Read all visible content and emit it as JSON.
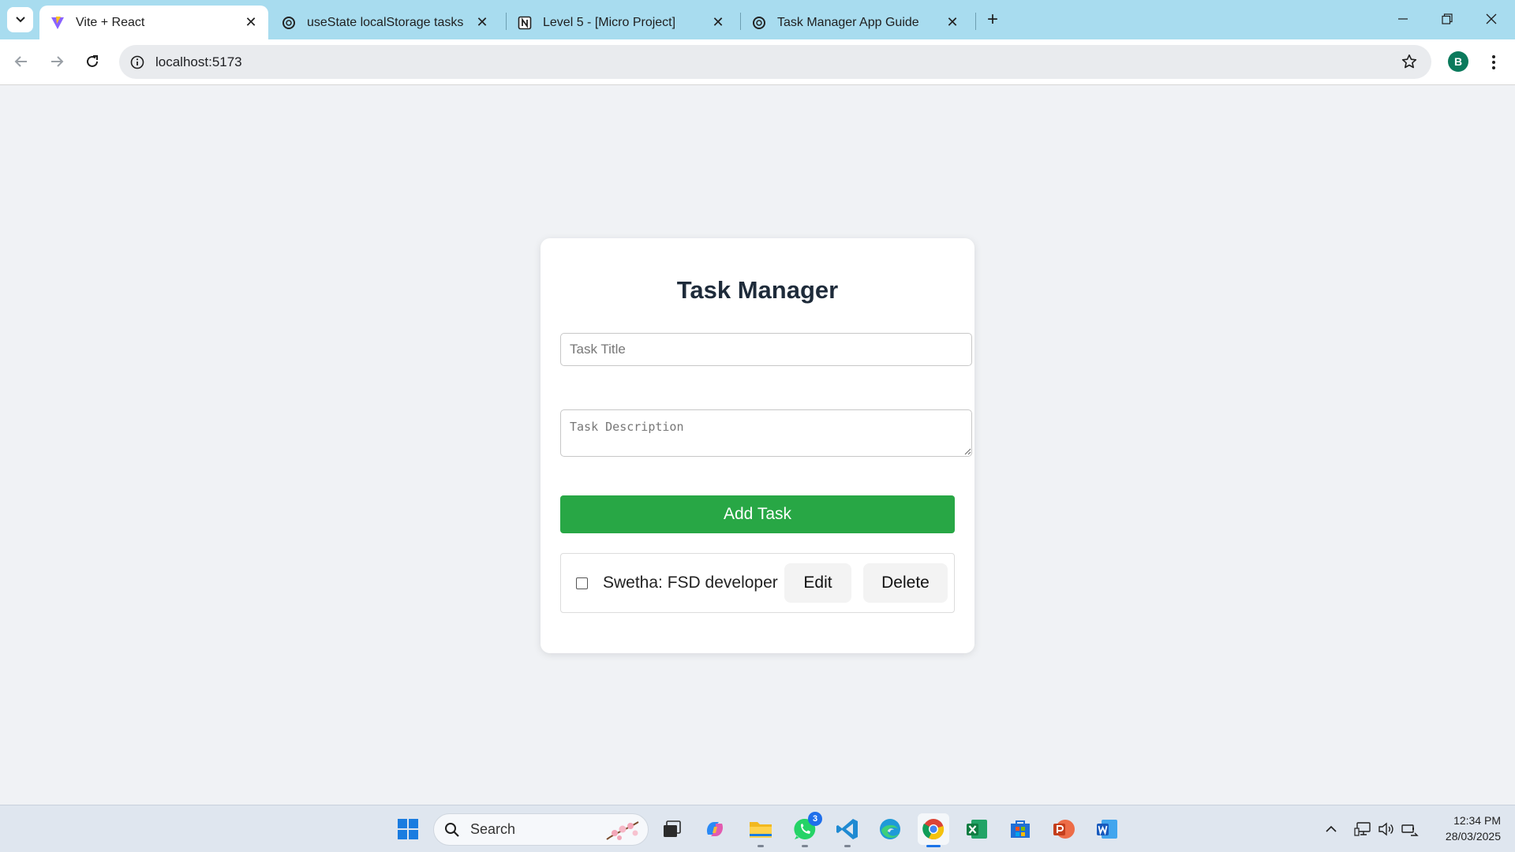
{
  "browser": {
    "tabs": [
      {
        "title": "Vite + React",
        "icon": "vite-icon",
        "active": true
      },
      {
        "title": "useState localStorage tasks",
        "icon": "chatgpt-icon",
        "active": false
      },
      {
        "title": "Level 5 - [Micro Project]",
        "icon": "notion-icon",
        "active": false
      },
      {
        "title": "Task Manager App Guide",
        "icon": "chatgpt-icon",
        "active": false
      }
    ],
    "url": "localhost:5173",
    "profile_initial": "B"
  },
  "app": {
    "title": "Task Manager",
    "title_placeholder": "Task Title",
    "description_placeholder": "Task Description",
    "add_button_label": "Add Task",
    "tasks": [
      {
        "text": "Swetha: FSD developer",
        "completed": false,
        "edit_label": "Edit",
        "delete_label": "Delete"
      }
    ],
    "colors": {
      "add_button": "#28a745",
      "title": "#1e2b3a"
    }
  },
  "taskbar": {
    "search_label": "Search",
    "whatsapp_badge": "3",
    "time": "12:34 PM",
    "date": "28/03/2025",
    "apps": [
      "windows-start-icon",
      "task-view-icon",
      "copilot-icon",
      "file-explorer-icon",
      "whatsapp-icon",
      "vscode-icon",
      "edge-icon",
      "chrome-icon",
      "excel-icon",
      "microsoft-store-icon",
      "powerpoint-icon",
      "word-icon"
    ]
  }
}
